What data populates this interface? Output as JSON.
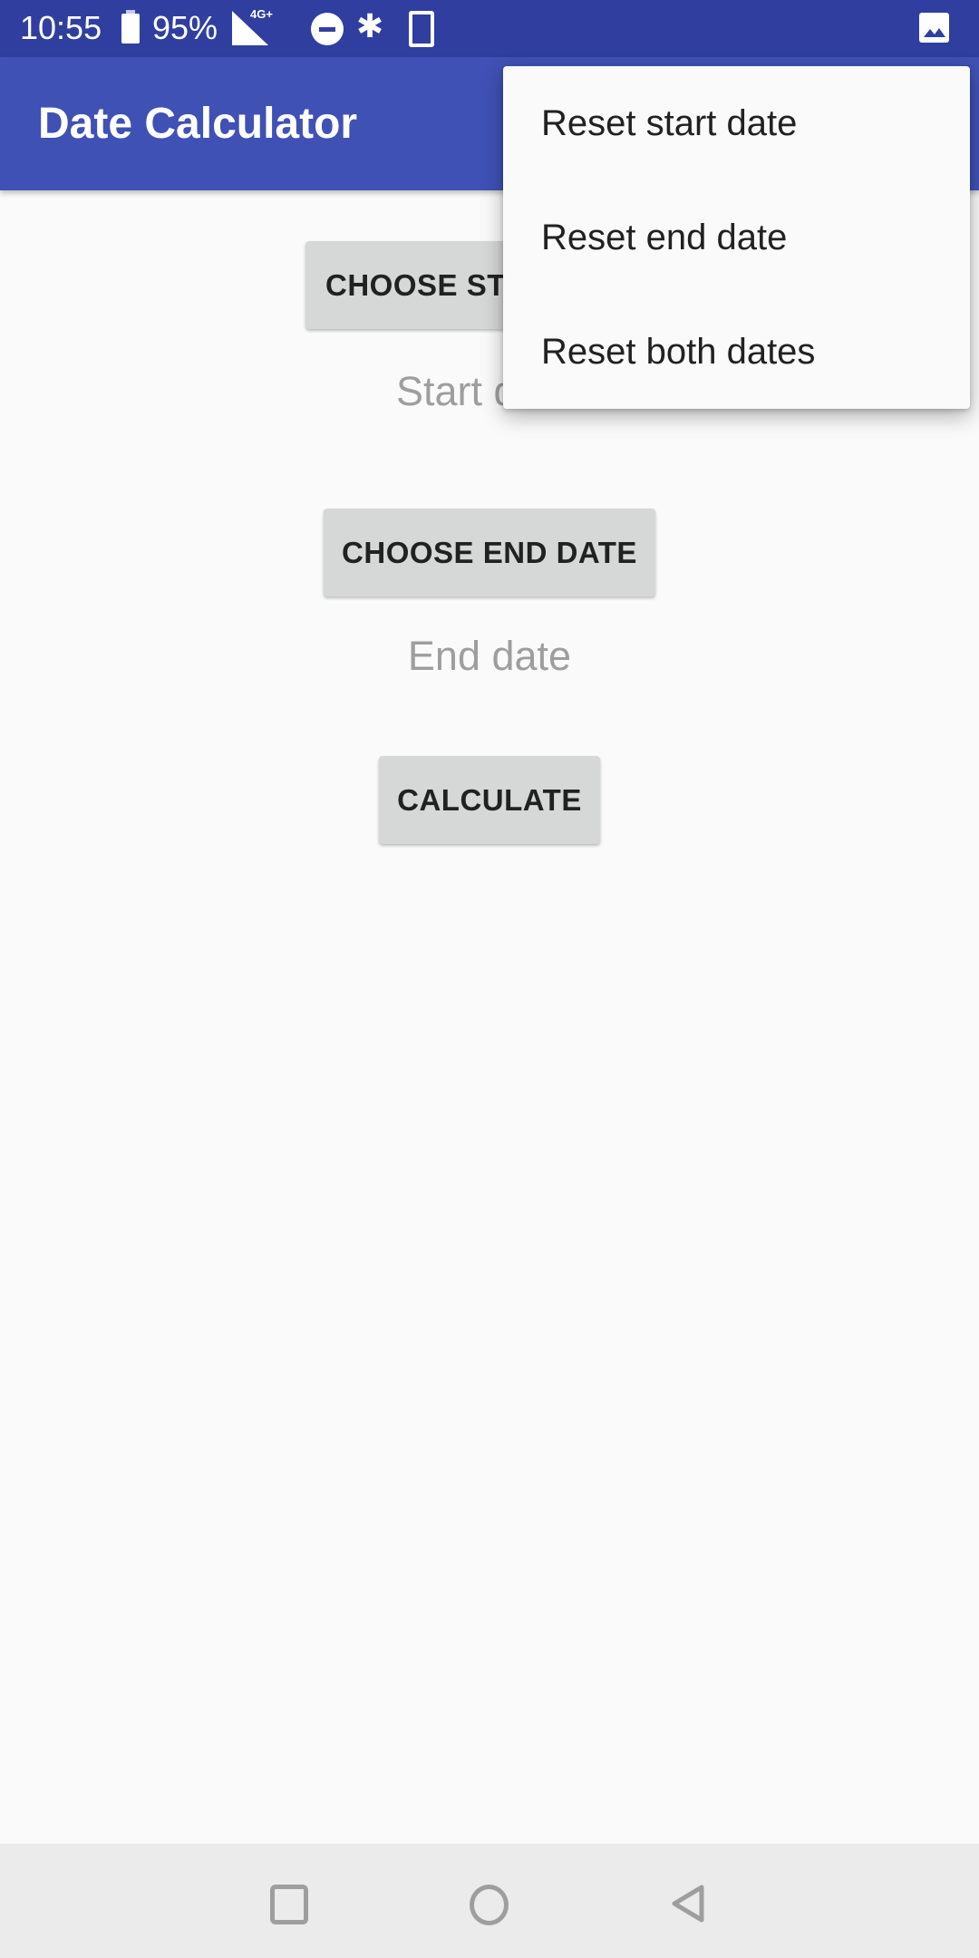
{
  "status_bar": {
    "time": "10:55",
    "battery_percent": "95%",
    "network": "4G+",
    "icons": [
      "battery-icon",
      "signal-icon",
      "do-not-disturb-icon",
      "bluetooth-icon",
      "phone-icon",
      "image-notification-icon"
    ],
    "bluetooth_glyph": "✱"
  },
  "app_bar": {
    "title": "Date Calculator"
  },
  "main": {
    "choose_start_label": "CHOOSE START DATE",
    "start_date_placeholder": "Start date",
    "choose_end_label": "CHOOSE END DATE",
    "end_date_placeholder": "End date",
    "calculate_label": "CALCULATE"
  },
  "overflow_menu": {
    "items": [
      {
        "label": "Reset start date"
      },
      {
        "label": "Reset end date"
      },
      {
        "label": "Reset both dates"
      }
    ]
  },
  "nav_bar": {
    "buttons": [
      "recents",
      "home",
      "back"
    ]
  },
  "colors": {
    "status_bar": "#303f9f",
    "app_bar": "#3f51b5",
    "button": "#d6d7d7",
    "placeholder_text": "#9e9e9e",
    "background": "#fafafa",
    "nav_bar": "#ebebeb"
  }
}
